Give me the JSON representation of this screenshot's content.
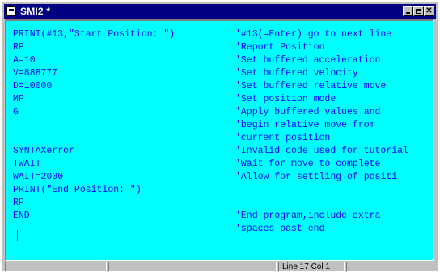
{
  "window": {
    "title": "SMI2 *"
  },
  "editor": {
    "lines": [
      {
        "code": "PRINT(#13,\"Start Position: \")",
        "comment": "'#13(=Enter) go to next line"
      },
      {
        "code": "RP",
        "comment": "'Report Position"
      },
      {
        "code": "A=10",
        "comment": "'Set buffered acceleration"
      },
      {
        "code": "V=888777",
        "comment": "'Set buffered velocity"
      },
      {
        "code": "D=10000",
        "comment": "'Set buffered relative move"
      },
      {
        "code": "MP",
        "comment": "'Set position mode"
      },
      {
        "code": "G",
        "comment": "'Apply buffered values and"
      },
      {
        "code": "",
        "comment": "'begin relative move from"
      },
      {
        "code": "",
        "comment": "'current position"
      },
      {
        "code": "SYNTAXerror",
        "comment": "'Invalid code used for tutorial"
      },
      {
        "code": "TWAIT",
        "comment": "'Wait for move to complete"
      },
      {
        "code": "WAIT=2000",
        "comment": "'Allow for settling of positi"
      },
      {
        "code": "PRINT(\"End Position: \")",
        "comment": ""
      },
      {
        "code": "RP",
        "comment": ""
      },
      {
        "code": "END",
        "comment": "'End program,include extra"
      },
      {
        "code": "",
        "comment": "'spaces past end"
      }
    ]
  },
  "status": {
    "pane1": "",
    "pane2": "",
    "position": "Line 17  Col 1",
    "pane4": ""
  },
  "colors": {
    "background": "#00ffff",
    "text": "#0000ff",
    "caret": "#ff0000",
    "titlebar": "#000080"
  }
}
